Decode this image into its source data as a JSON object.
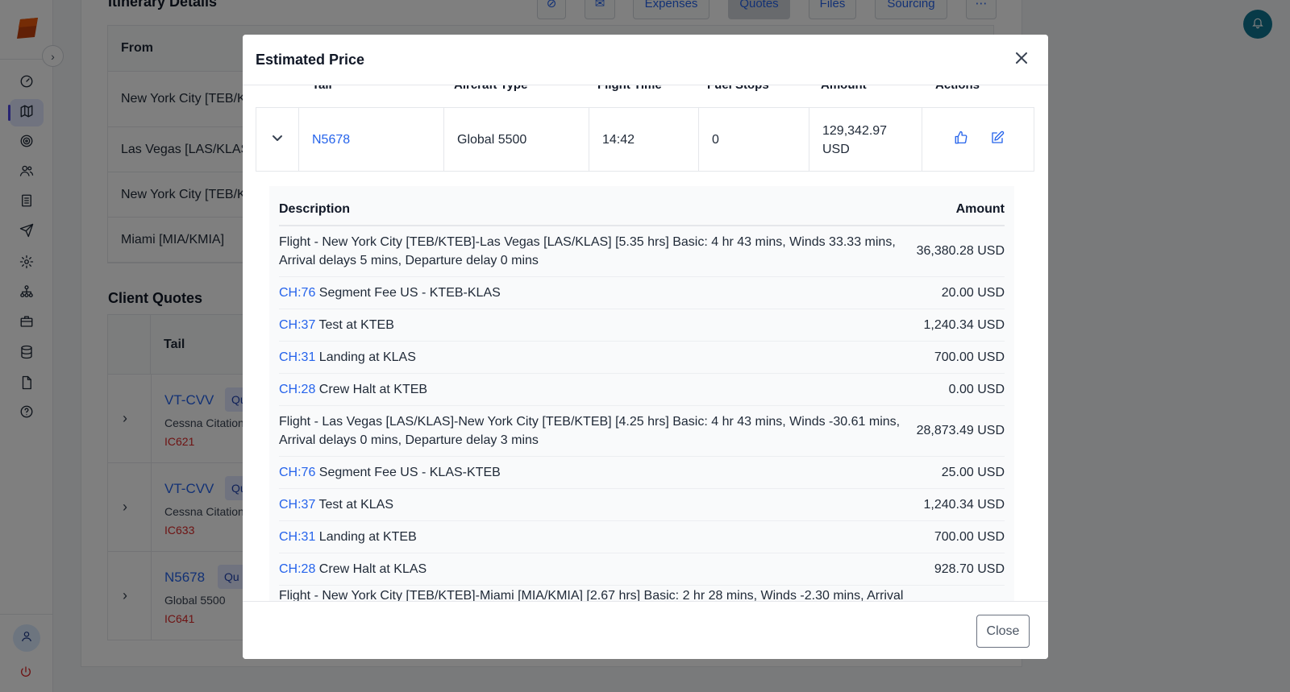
{
  "background": {
    "itinerary_title": "Itinerary Details",
    "toolbar": [
      "Expenses",
      "Quotes",
      "Files",
      "Sourcing"
    ],
    "itinerary": {
      "header_from": "From",
      "rows": [
        "New York City [TEB/K",
        "Las Vegas [LAS/KLAS",
        "New York City [TEB/K",
        "Miami [MIA/KMIA]"
      ]
    },
    "client_quotes_title": "Client Quotes",
    "client_quotes": {
      "header_tail": "Tail",
      "rows": [
        {
          "tail": "VT-CVV",
          "badge": "Qu",
          "type": "Cessna Citation",
          "code": "IC621"
        },
        {
          "tail": "VT-CVV",
          "badge": "Qu",
          "type": "Cessna Citation",
          "code": "IC633"
        },
        {
          "tail": "N5678",
          "badge": "Qu",
          "type": "Global 5500",
          "code": "IC641"
        }
      ]
    }
  },
  "modal": {
    "title": "Estimated Price",
    "close_label": "Close",
    "quote_table": {
      "headers": [
        "Tail",
        "Aircraft Type",
        "Flight Time",
        "Fuel Stops",
        "Amount",
        "Actions"
      ],
      "row": {
        "tail": "N5678",
        "aircraft_type": "Global 5500",
        "flight_time": "14:42",
        "fuel_stops": "0",
        "amount_line1": "129,342.97",
        "amount_line2": "USD"
      }
    },
    "breakdown": {
      "header_description": "Description",
      "header_amount": "Amount",
      "rows": [
        {
          "code": "",
          "text": "Flight - New York City [TEB/KTEB]-Las Vegas [LAS/KLAS] [5.35 hrs] Basic: 4 hr 43 mins, Winds 33.33 mins, Arrival delays 5 mins, Departure delay 0 mins",
          "amount": "36,380.28 USD"
        },
        {
          "code": "CH:76",
          "text": " Segment Fee US - KTEB-KLAS",
          "amount": "20.00 USD"
        },
        {
          "code": "CH:37",
          "text": " Test at KTEB",
          "amount": "1,240.34 USD"
        },
        {
          "code": "CH:31",
          "text": " Landing at KLAS",
          "amount": "700.00 USD"
        },
        {
          "code": "CH:28",
          "text": " Crew Halt at KTEB",
          "amount": "0.00 USD"
        },
        {
          "code": "",
          "text": "Flight - Las Vegas [LAS/KLAS]-New York City [TEB/KTEB] [4.25 hrs] Basic: 4 hr 43 mins, Winds -30.61 mins, Arrival delays 0 mins, Departure delay 3 mins",
          "amount": "28,873.49 USD"
        },
        {
          "code": "CH:76",
          "text": " Segment Fee US - KLAS-KTEB",
          "amount": "25.00 USD"
        },
        {
          "code": "CH:37",
          "text": " Test at KLAS",
          "amount": "1,240.34 USD"
        },
        {
          "code": "CH:31",
          "text": " Landing at KTEB",
          "amount": "700.00 USD"
        },
        {
          "code": "CH:28",
          "text": " Crew Halt at KLAS",
          "amount": "928.70 USD"
        },
        {
          "code": "",
          "text": "Flight - New York City [TEB/KTEB]-Miami [MIA/KMIA] [2.67 hrs] Basic: 2 hr 28 mins, Winds -2.30 mins, Arrival",
          "amount": ""
        }
      ]
    }
  }
}
